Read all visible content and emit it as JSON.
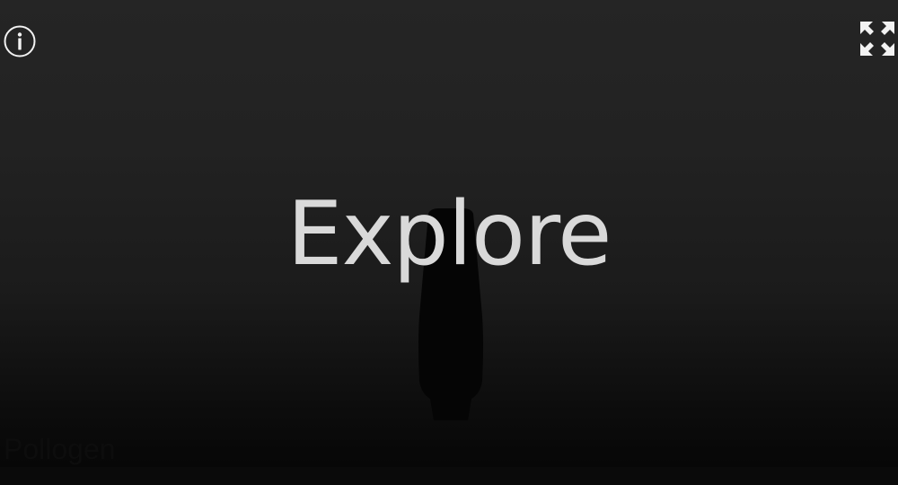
{
  "viewer": {
    "headline": "Explore",
    "model_label": "Pollogen"
  },
  "controls": {
    "info_icon": "info-icon",
    "fullscreen_icon": "expand-arrows-icon"
  },
  "colors": {
    "background_top": "#252525",
    "background_bottom": "#050505",
    "headline": "#d9d9d9",
    "icon": "#f2f2f2",
    "model_label": "#0d0d0d"
  }
}
